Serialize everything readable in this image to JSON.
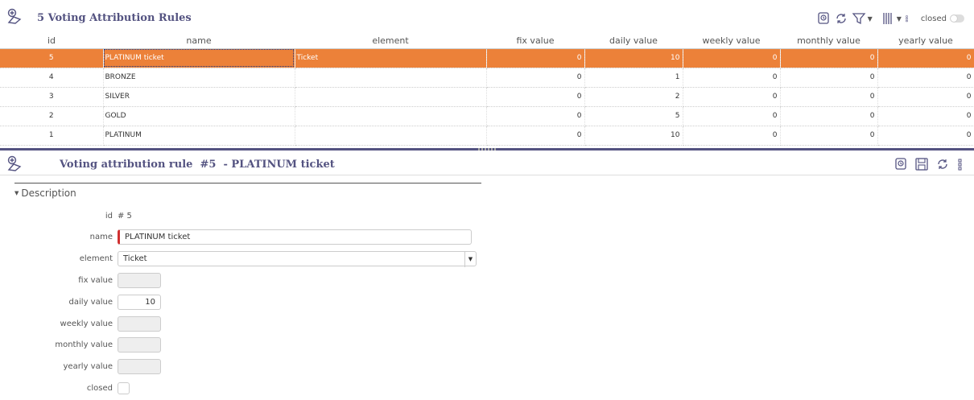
{
  "list": {
    "title": "5 Voting Attribution Rules",
    "closed_label": "closed",
    "columns": [
      "id",
      "name",
      "element",
      "fix value",
      "daily value",
      "weekly value",
      "monthly value",
      "yearly value"
    ],
    "rows": [
      {
        "id": "5",
        "name": "PLATINUM ticket",
        "element": "Ticket",
        "fix": "0",
        "daily": "10",
        "weekly": "0",
        "monthly": "0",
        "yearly": "0"
      },
      {
        "id": "4",
        "name": "BRONZE",
        "element": "",
        "fix": "0",
        "daily": "1",
        "weekly": "0",
        "monthly": "0",
        "yearly": "0"
      },
      {
        "id": "3",
        "name": "SILVER",
        "element": "",
        "fix": "0",
        "daily": "2",
        "weekly": "0",
        "monthly": "0",
        "yearly": "0"
      },
      {
        "id": "2",
        "name": "GOLD",
        "element": "",
        "fix": "0",
        "daily": "5",
        "weekly": "0",
        "monthly": "0",
        "yearly": "0"
      },
      {
        "id": "1",
        "name": "PLATINUM",
        "element": "",
        "fix": "0",
        "daily": "10",
        "weekly": "0",
        "monthly": "0",
        "yearly": "0"
      }
    ],
    "selected_row": "5"
  },
  "detail": {
    "title": "Voting attribution rule  #5  - PLATINUM ticket",
    "section_label": "Description",
    "fields": {
      "id_label": "id",
      "id_value": "# 5",
      "name_label": "name",
      "name_value": "PLATINUM ticket",
      "element_label": "element",
      "element_value": "Ticket",
      "fix_label": "fix value",
      "fix_value": "",
      "daily_label": "daily value",
      "daily_value": "10",
      "weekly_label": "weekly value",
      "weekly_value": "",
      "monthly_label": "monthly value",
      "monthly_value": "",
      "yearly_label": "yearly value",
      "yearly_value": "",
      "closed_label": "closed"
    }
  },
  "colors": {
    "accent": "#545381",
    "selected_row": "#ec8139",
    "required_marker": "#d03030"
  },
  "icons": [
    "voting-rule-icon",
    "print-icon",
    "refresh-icon",
    "filter-icon",
    "columns-icon",
    "more-vertical-icon",
    "save-icon"
  ]
}
